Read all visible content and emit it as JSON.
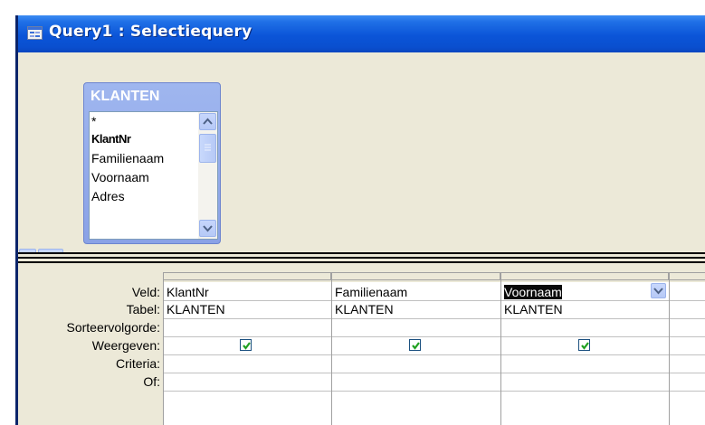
{
  "window": {
    "title": "Query1 : Selectiequery",
    "icon": "query-icon"
  },
  "table_box": {
    "title": "KLANTEN",
    "fields": [
      "*",
      "KlantNr",
      "Familienaam",
      "Voornaam",
      "Adres"
    ],
    "primary_key_field": "KlantNr"
  },
  "grid": {
    "row_labels": {
      "field": "Veld:",
      "table": "Tabel:",
      "sort": "Sorteervolgorde:",
      "show": "Weergeven:",
      "criteria": "Criteria:",
      "or": "Of:"
    },
    "columns": [
      {
        "field": "KlantNr",
        "table": "KLANTEN",
        "show": true
      },
      {
        "field": "Familienaam",
        "table": "KLANTEN",
        "show": true
      },
      {
        "field": "Voornaam",
        "table": "KLANTEN",
        "show": true,
        "selected": true
      }
    ]
  },
  "colors": {
    "title_bar": "#0b55d8",
    "table_box_header": "#8aa2e6",
    "window_bg": "#ece9d8",
    "checkbox_check": "#21a121"
  }
}
